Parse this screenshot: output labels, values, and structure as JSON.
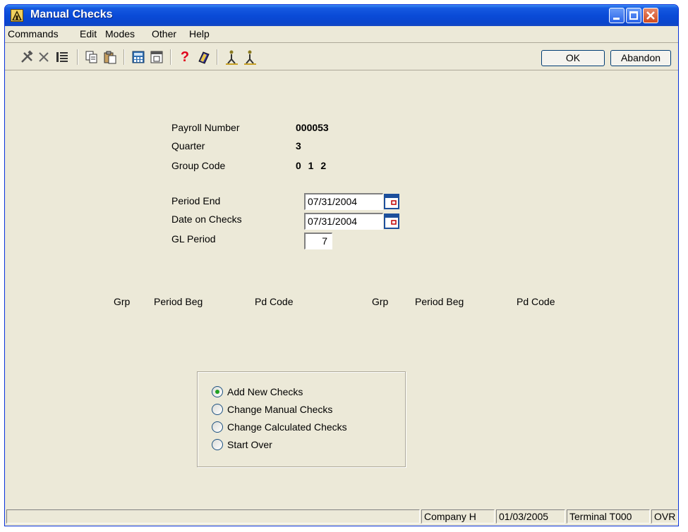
{
  "window": {
    "title": "Manual Checks",
    "controls": [
      "minimize",
      "maximize",
      "close"
    ]
  },
  "menu": {
    "items": [
      "Commands",
      "Edit",
      "Modes",
      "Other",
      "Help"
    ]
  },
  "toolbar": {
    "icons": [
      "tools-icon",
      "delete-x-icon",
      "list-icon",
      "copy-icon",
      "paste-icon",
      "calculator-icon",
      "calendar-icon",
      "help-question-icon",
      "book-icon",
      "person-icon",
      "person-icon-2"
    ],
    "ok_label": "OK",
    "abandon_label": "Abandon"
  },
  "info": {
    "payroll_number_label": "Payroll Number",
    "payroll_number": "000053",
    "quarter_label": "Quarter",
    "quarter": "3",
    "group_code_label": "Group Code",
    "group_code": "0 1 2"
  },
  "dates": {
    "period_end_label": "Period End",
    "period_end": "07/31/2004",
    "date_on_checks_label": "Date on Checks",
    "date_on_checks": "07/31/2004",
    "gl_period_label": "GL Period",
    "gl_period": "7"
  },
  "grid": {
    "headers": [
      "Grp",
      "Period Beg",
      "Pd Code",
      "Grp",
      "Period Beg",
      "Pd Code"
    ]
  },
  "options": {
    "items": [
      "Add New Checks",
      "Change Manual Checks",
      "Change Calculated Checks",
      "Start Over"
    ],
    "selected": "Add New Checks"
  },
  "status": {
    "company": "Company H",
    "date": "01/03/2005",
    "terminal": "Terminal T000",
    "mode": "OVR"
  },
  "colors": {
    "titlebar": "#0a4bd8",
    "window_bg": "#ece9d8",
    "radio_dot": "#21a121"
  }
}
